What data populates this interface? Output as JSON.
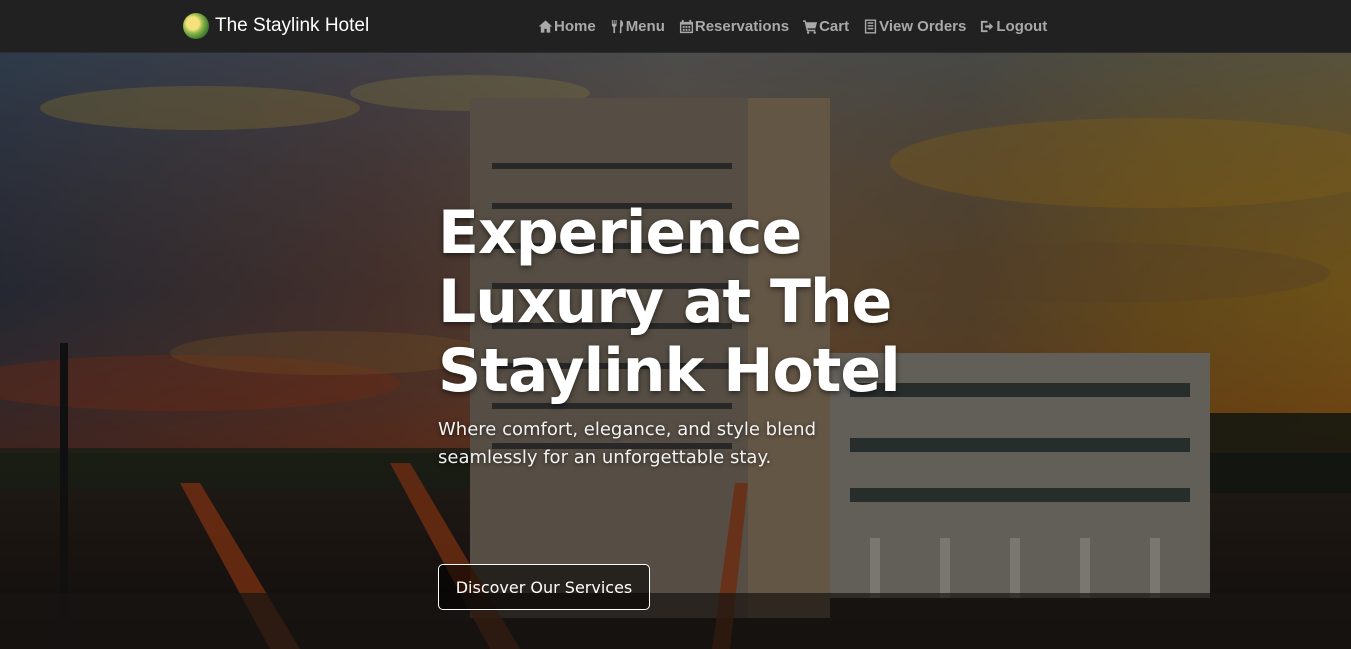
{
  "navbar": {
    "brand": {
      "title": "The Staylink Hotel",
      "logo_icon": "hotel-logo-icon"
    },
    "links": [
      {
        "label": "Home",
        "icon": "home-icon"
      },
      {
        "label": "Menu",
        "icon": "utensils-icon"
      },
      {
        "label": "Reservations",
        "icon": "calendar-icon"
      },
      {
        "label": "Cart",
        "icon": "cart-icon"
      },
      {
        "label": "View Orders",
        "icon": "list-icon"
      },
      {
        "label": "Logout",
        "icon": "logout-icon"
      }
    ]
  },
  "hero": {
    "title": "Experience Luxury at The Staylink Hotel",
    "subtitle": "Where comfort, elegance, and style blend seamlessly for an unforgettable stay.",
    "button_label": "Discover Our Services",
    "background_image": "hotel-building-at-sunset"
  },
  "colors": {
    "navbar_bg": "#212121",
    "nav_link": "#a9a9a9",
    "hero_text": "#ffffff"
  }
}
